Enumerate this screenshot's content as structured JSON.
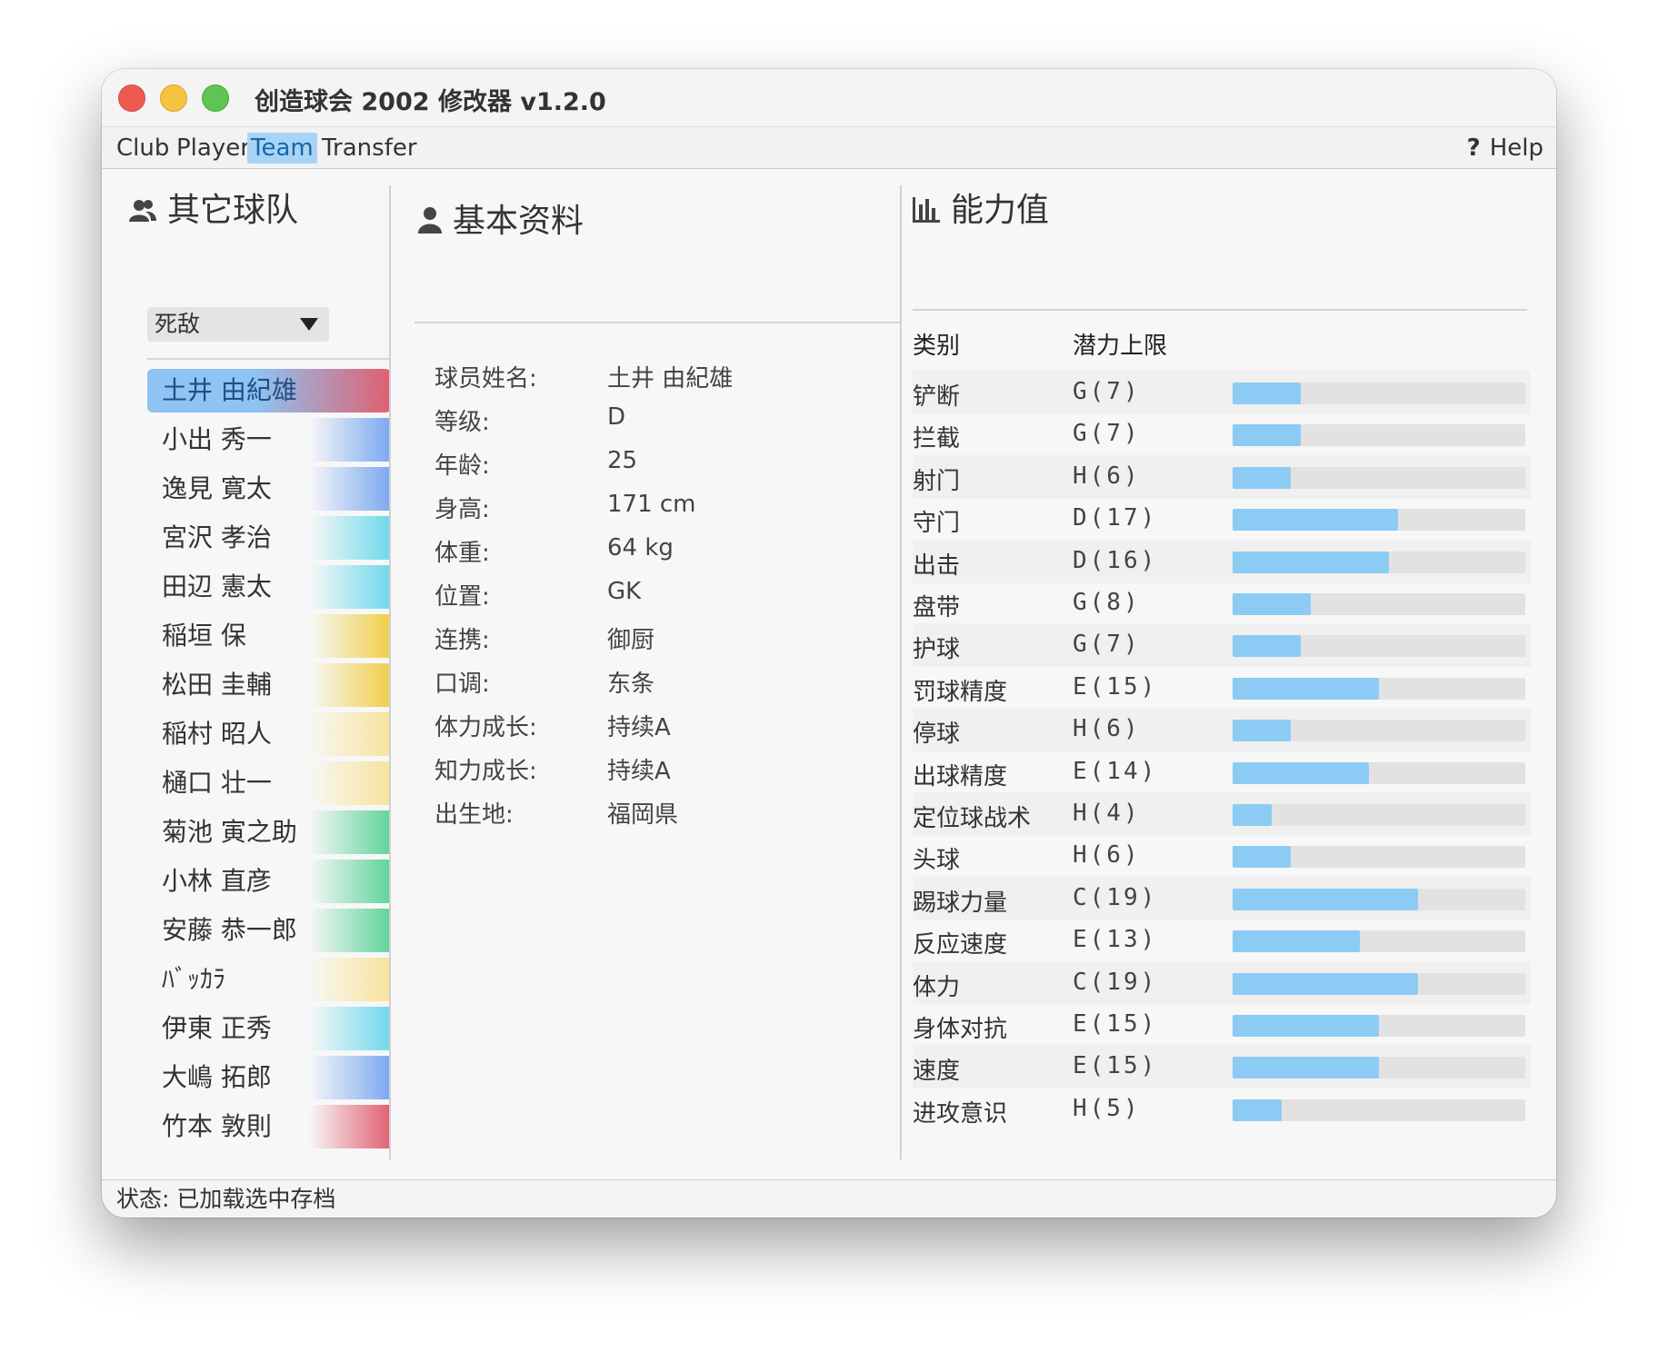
{
  "window": {
    "title": "创造球会 2002 修改器 v1.2.0"
  },
  "menu": {
    "items": [
      {
        "label": "Club",
        "active": false
      },
      {
        "label": "Player",
        "active": false
      },
      {
        "label": "Team",
        "active": true
      },
      {
        "label": "Transfer",
        "active": false
      }
    ],
    "help_icon": "?",
    "help_label": "Help"
  },
  "other_teams": {
    "heading": "其它球队",
    "icon": "users-icon",
    "select_value": "死敌",
    "players": [
      {
        "name": "土井 由紀雄",
        "color": "#e06070",
        "selected": true
      },
      {
        "name": "小出 秀一",
        "color": "#7aa8f0"
      },
      {
        "name": "逸見 寛太",
        "color": "#7aa8f0"
      },
      {
        "name": "宮沢 孝治",
        "color": "#6fd8ec"
      },
      {
        "name": "田辺 憲太",
        "color": "#6fd8ec"
      },
      {
        "name": "稲垣 保",
        "color": "#f0cf48"
      },
      {
        "name": "松田 圭輔",
        "color": "#f0cf48"
      },
      {
        "name": "稲村 昭人",
        "color": "#f7e39a"
      },
      {
        "name": "樋口 壮一",
        "color": "#f7e39a"
      },
      {
        "name": "菊池 寅之助",
        "color": "#5fd39a"
      },
      {
        "name": "小林 直彦",
        "color": "#5fd39a"
      },
      {
        "name": "安藤 恭一郎",
        "color": "#5fd39a"
      },
      {
        "name": "ﾊﾞｯｶﾗ",
        "color": "#f7e39a"
      },
      {
        "name": "伊東 正秀",
        "color": "#6fd8ec"
      },
      {
        "name": "大嶋 拓郎",
        "color": "#7aa8f0"
      },
      {
        "name": "竹本 敦則",
        "color": "#e06070"
      }
    ]
  },
  "basic_info": {
    "heading": "基本资料",
    "icon": "user-icon",
    "rows": [
      {
        "label": "球员姓名:",
        "value": "土井 由紀雄"
      },
      {
        "label": "等级:",
        "value": "D"
      },
      {
        "label": "年龄:",
        "value": "25"
      },
      {
        "label": "身高:",
        "value": "171 cm"
      },
      {
        "label": "体重:",
        "value": "64 kg"
      },
      {
        "label": "位置:",
        "value": "GK"
      },
      {
        "label": "连携:",
        "value": "御厨"
      },
      {
        "label": "口调:",
        "value": "东条"
      },
      {
        "label": "体力成长:",
        "value": "持续A"
      },
      {
        "label": "知力成长:",
        "value": "持续A"
      },
      {
        "label": "出生地:",
        "value": "福岡県"
      }
    ]
  },
  "abilities": {
    "heading": "能力值",
    "icon": "bar-chart-icon",
    "col_category": "类别",
    "col_potential": "潜力上限",
    "bar_max": 30,
    "rows": [
      {
        "category": "铲断",
        "grade": "G(7)",
        "value": 7
      },
      {
        "category": "拦截",
        "grade": "G(7)",
        "value": 7
      },
      {
        "category": "射门",
        "grade": "H(6)",
        "value": 6
      },
      {
        "category": "守门",
        "grade": "D(17)",
        "value": 17
      },
      {
        "category": "出击",
        "grade": "D(16)",
        "value": 16
      },
      {
        "category": "盘带",
        "grade": "G(8)",
        "value": 8
      },
      {
        "category": "护球",
        "grade": "G(7)",
        "value": 7
      },
      {
        "category": "罚球精度",
        "grade": "E(15)",
        "value": 15
      },
      {
        "category": "停球",
        "grade": "H(6)",
        "value": 6
      },
      {
        "category": "出球精度",
        "grade": "E(14)",
        "value": 14
      },
      {
        "category": "定位球战术",
        "grade": "H(4)",
        "value": 4
      },
      {
        "category": "头球",
        "grade": "H(6)",
        "value": 6
      },
      {
        "category": "踢球力量",
        "grade": "C(19)",
        "value": 19
      },
      {
        "category": "反应速度",
        "grade": "E(13)",
        "value": 13
      },
      {
        "category": "体力",
        "grade": "C(19)",
        "value": 19
      },
      {
        "category": "身体对抗",
        "grade": "E(15)",
        "value": 15
      },
      {
        "category": "速度",
        "grade": "E(15)",
        "value": 15
      },
      {
        "category": "进攻意识",
        "grade": "H(5)",
        "value": 5
      }
    ]
  },
  "status": {
    "text": "状态:  已加载选中存档"
  }
}
